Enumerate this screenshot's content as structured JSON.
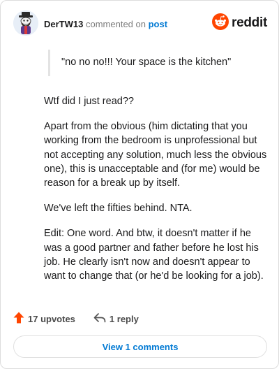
{
  "header": {
    "username": "DerTW13",
    "action_text": "commented on",
    "post_link": "post",
    "brand": "reddit"
  },
  "icons": {
    "avatar": "snoo-avatar-icon",
    "brand_logo": "reddit-snoo-icon",
    "upvote": "upvote-arrow-icon",
    "reply": "reply-arrow-icon"
  },
  "colors": {
    "brand_orange": "#ff4500",
    "link_blue": "#0079d3",
    "upvote_orange": "#ff4500"
  },
  "comment": {
    "quote": "\"no no no!!! Your space is the kitchen\"",
    "paragraphs": [
      "Wtf did I just read??",
      "Apart from the obvious (him dictating that you working from the bedroom is unprofessional but not accepting any solution, much less the obvious one), this is unacceptable and (for me) would be reason for a break up by itself.",
      "We've left the fifties behind. NTA.",
      "Edit: One word. And btw, it doesn't matter if he was a good partner and father before he lost his job. He clearly isn't now and doesn't appear to want to change that (or he'd be looking for a job)."
    ]
  },
  "footer": {
    "upvotes": "17 upvotes",
    "replies": "1 reply",
    "view_button": "View 1 comments"
  }
}
